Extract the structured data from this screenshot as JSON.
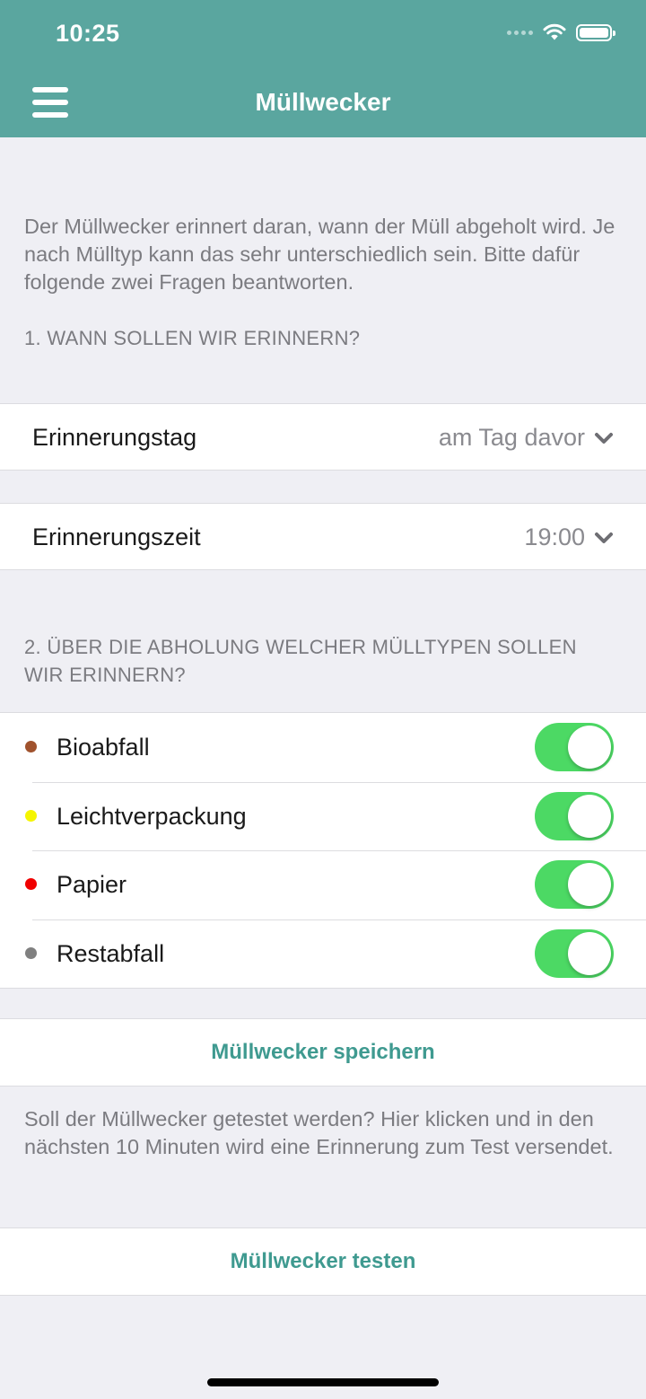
{
  "status_bar": {
    "time": "10:25"
  },
  "header": {
    "title": "Müllwecker",
    "menu_icon": "hamburger-menu-icon",
    "background_color": "#5aa69f"
  },
  "intro": {
    "text": "Der Müllwecker erinnert daran, wann der Müll abgeholt wird. Je nach Mülltyp kann das sehr unterschiedlich sein. Bitte dafür folgende zwei Fragen beantworten."
  },
  "section1": {
    "label": "1. WANN SOLLEN WIR ERINNERN?"
  },
  "reminder_day": {
    "label": "Erinnerungstag",
    "value": "am Tag davor"
  },
  "reminder_time": {
    "label": "Erinnerungszeit",
    "value": "19:00"
  },
  "section2": {
    "label": "2. ÜBER DIE ABHOLUNG WELCHER MÜLLTYPEN SOLLEN WIR ERINNERN?"
  },
  "waste_types": [
    {
      "label": "Bioabfall",
      "color": "#a0522d",
      "enabled": true
    },
    {
      "label": "Leichtverpackung",
      "color": "#f5f500",
      "enabled": true
    },
    {
      "label": "Papier",
      "color": "#f00000",
      "enabled": true
    },
    {
      "label": "Restabfall",
      "color": "#808080",
      "enabled": true
    }
  ],
  "actions": {
    "save_label": "Müllwecker speichern",
    "test_hint": "Soll der Müllwecker getestet werden? Hier klicken und in den nächsten 10 Minuten wird eine Erinnerung zum Test versendet.",
    "test_label": "Müllwecker testen",
    "accent_color": "#3f9a90"
  },
  "colors": {
    "toggle_on": "#4cd964",
    "background": "#efeff4"
  }
}
